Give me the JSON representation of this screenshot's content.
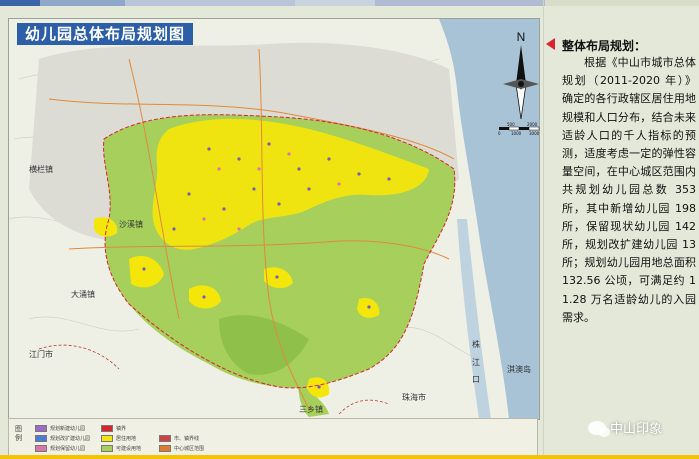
{
  "colors": {
    "title_bg": "#2c5fa8",
    "accent_red": "#d9232d",
    "kindergarten_yellow": "#f5e60a",
    "green_land": "#a6cf5c",
    "urban_gray": "#d4d4d4",
    "water": "#a9c3d6"
  },
  "map": {
    "title": "幼儿园总体布局规划图",
    "north_letter": "N",
    "scale_labels": [
      "500",
      "2000",
      "0",
      "1000",
      "3000"
    ],
    "place_labels": [
      {
        "text": "江门市",
        "name": "place-jiangmen"
      },
      {
        "text": "珠海市",
        "name": "place-zhuhai"
      },
      {
        "text": "株",
        "name": "place-zhu-1"
      },
      {
        "text": "江",
        "name": "place-zhu-2"
      },
      {
        "text": "口",
        "name": "place-zhu-3"
      },
      {
        "text": "大涌镇",
        "name": "place-dayong"
      },
      {
        "text": "沙溪镇",
        "name": "place-shaxi"
      },
      {
        "text": "横栏镇",
        "name": "place-henglan"
      },
      {
        "text": "三乡镇",
        "name": "place-sanxiang"
      },
      {
        "text": "淇澳岛",
        "name": "place-qiao"
      }
    ]
  },
  "legend": {
    "head": [
      "图",
      "例"
    ],
    "items": [
      {
        "label": "规划新建幼儿园",
        "color": "#9a6bc9"
      },
      {
        "label": "规划改扩建幼儿园",
        "color": "#4b7bd6"
      },
      {
        "label": "规划保留幼儿园",
        "color": "#d975a8"
      },
      {
        "label": "镇界",
        "color": "#d9232d"
      },
      {
        "label": "居住用地",
        "color": "#f5e60a"
      },
      {
        "label": "可建设用地",
        "color": "#a6cf5c"
      },
      {
        "label": "市、镇界线",
        "color": "#c44"
      },
      {
        "label": "中心城区范围",
        "color": "#e07a2e"
      }
    ]
  },
  "panel": {
    "heading": "整体布局规划：",
    "body": "根据《中山市城市总体规划（2011-2020 年）》确定的各行政辖区居住用地规模和人口分布，结合未来适龄人口的千人指标的预测，适度考虑一定的弹性容量空间，在中心城区范围内共规划幼儿园总数 353 所，其中新增幼儿园 198 所，保留现状幼儿园 142 所，规划改扩建幼儿园 13 所；规划幼儿园用地总面积 132.56 公顷，可满足约 11.28 万名适龄幼儿的入园需求。"
  },
  "watermark": {
    "text": "中山印象",
    "icon": "wechat-icon"
  }
}
